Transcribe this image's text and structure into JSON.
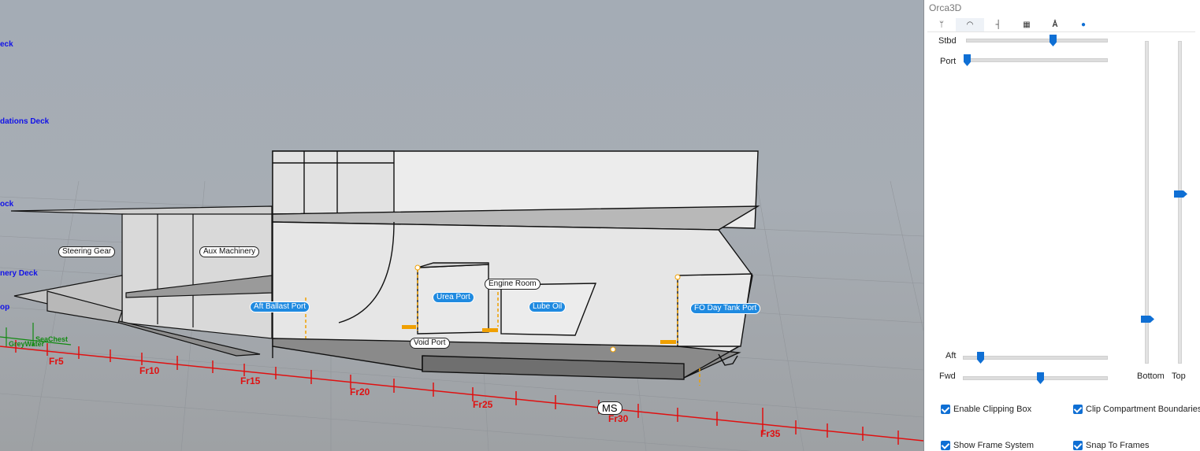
{
  "viewport": {
    "decks": [
      "eck",
      "dations Deck",
      "ock",
      "nery Deck",
      "op"
    ],
    "compartments_white": [
      "Steering Gear",
      "Aux Machinery",
      "Engine Room",
      "Void Port"
    ],
    "compartments_blue": [
      "Aft Ballast Port",
      "Urea Port",
      "Lube Oil",
      "FO Day Tank Port"
    ],
    "frames": [
      "Fr5",
      "Fr10",
      "Fr15",
      "Fr20",
      "Fr25",
      "Fr30",
      "Fr35"
    ],
    "midship": "MS",
    "green_labels": [
      "SeaChest",
      "GreyWater"
    ]
  },
  "panel": {
    "title": "Orca3D",
    "tabs": [
      "wifi-ish",
      "eye",
      "axis",
      "grid",
      "person",
      "info"
    ],
    "sliders": {
      "stbd": {
        "label": "Stbd",
        "value": 0.62
      },
      "port": {
        "label": "Port",
        "value": 0.01
      },
      "aft": {
        "label": "Aft",
        "value": 0.13
      },
      "fwd": {
        "label": "Fwd",
        "value": 0.54
      },
      "bottom": {
        "label": "Bottom",
        "value": 0.13
      },
      "top": {
        "label": "Top",
        "value": 0.53
      }
    },
    "checkboxes": {
      "enable_clipping_box": {
        "label": "Enable Clipping Box",
        "checked": true
      },
      "clip_compartment_boundaries": {
        "label": "Clip Compartment Boundaries",
        "checked": true
      },
      "show_frame_system": {
        "label": "Show Frame System",
        "checked": true
      },
      "snap_to_frames": {
        "label": "Snap To Frames",
        "checked": true
      }
    }
  },
  "colors": {
    "accent": "#0f6fd4",
    "frame_line": "#e01010",
    "deck_label": "#1212e8"
  }
}
